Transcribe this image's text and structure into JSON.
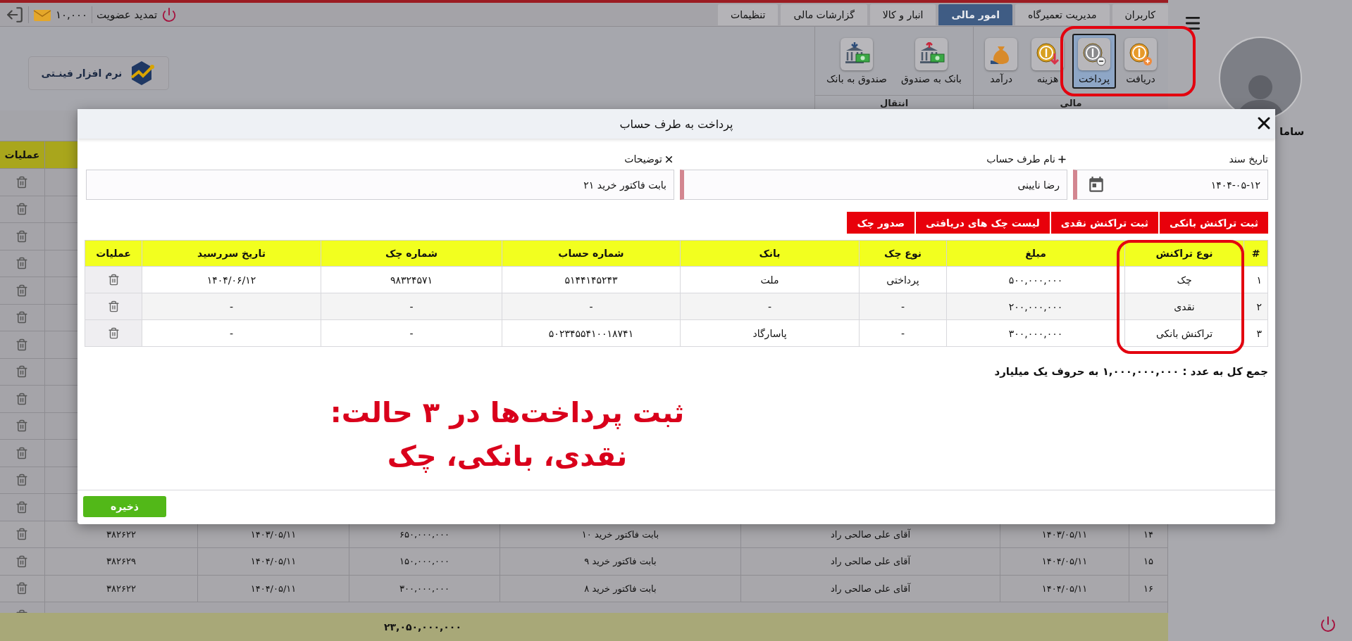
{
  "top_bar": {
    "sms_balance": "۱۰,۰۰۰",
    "renew_label": "تمدید عضویت"
  },
  "menu_tabs": [
    {
      "label": "کاربران",
      "selected": false
    },
    {
      "label": "مدیریت تعمیرگاه",
      "selected": false
    },
    {
      "label": "امور مالی",
      "selected": true
    },
    {
      "label": "انبار و کالا",
      "selected": false
    },
    {
      "label": "گزارشات مالی",
      "selected": false
    },
    {
      "label": "تنظیمات",
      "selected": false
    }
  ],
  "ribbon": {
    "groups": [
      {
        "title": "مالی",
        "items": [
          {
            "label": "دریافت",
            "selected": false
          },
          {
            "label": "پرداخت",
            "selected": true
          },
          {
            "label": "هزینه",
            "selected": false
          },
          {
            "label": "درآمد",
            "selected": false
          }
        ]
      },
      {
        "title": "انتقال",
        "items": [
          {
            "label": "بانک به صندوق",
            "selected": false
          },
          {
            "label": "صندوق به بانک",
            "selected": false
          }
        ]
      }
    ]
  },
  "logo": {
    "text": "نرم افزار فینـتی"
  },
  "sidebar": {
    "user_name": "ساما"
  },
  "background_table": {
    "operations_header": "عملیات",
    "total": "۲۳,۰۵۰,۰۰۰,۰۰۰",
    "rows": [
      {
        "covered": true
      },
      {
        "covered": true
      },
      {
        "covered": true
      },
      {
        "covered": true
      },
      {
        "covered": true
      },
      {
        "covered": true
      },
      {
        "covered": true
      },
      {
        "covered": true
      },
      {
        "covered": true
      },
      {
        "covered": true
      },
      {
        "covered": true
      },
      {
        "covered": true
      },
      {
        "covered": true
      },
      {
        "covered": false,
        "cells": [
          "۱۴",
          "۱۴۰۳/۰۵/۱۱",
          "آقای علی صالحی راد",
          "بابت فاکتور خرید ۱۰",
          "۶۵۰,۰۰۰,۰۰۰",
          "۱۴۰۳/۰۵/۱۱",
          "۳۸۲۶۲۲"
        ]
      },
      {
        "covered": false,
        "cells": [
          "۱۵",
          "۱۴۰۴/۰۵/۱۱",
          "آقای علی صالحی راد",
          "بابت فاکتور خرید ۹",
          "۱۵۰,۰۰۰,۰۰۰",
          "۱۴۰۴/۰۵/۱۱",
          "۳۸۲۶۲۹"
        ]
      },
      {
        "covered": false,
        "cells": [
          "۱۶",
          "۱۴۰۴/۰۵/۱۱",
          "آقای علی صالحی راد",
          "بابت فاکتور خرید ۸",
          "۳۰۰,۰۰۰,۰۰۰",
          "۱۴۰۴/۰۵/۱۱",
          "۳۸۲۶۲۲"
        ]
      },
      {
        "covered": true
      }
    ]
  },
  "dialog": {
    "title": "پرداخت به طرف حساب",
    "fields": [
      {
        "label": "تاریخ سند",
        "value": "۱۴۰۴-۰۵-۱۲",
        "kind": "date",
        "required": true
      },
      {
        "label": "نام طرف حساب",
        "value": "رضا نایینی",
        "kind": "add",
        "required": true
      },
      {
        "label": "توضیحات",
        "value": "بابت فاکتور خرید ۲۱",
        "kind": "clear",
        "required": false
      }
    ],
    "actions": [
      "ثبت تراکنش بانکی",
      "ثبت تراکنش نقدی",
      "لیست چک های دریافتی",
      "صدور چک"
    ],
    "table": {
      "columns": [
        "#",
        "نوع تراکنش",
        "مبلغ",
        "نوع چک",
        "بانک",
        "شماره حساب",
        "شماره چک",
        "تاریخ سررسید",
        "عملیات"
      ],
      "rows": [
        {
          "cells": [
            "۱",
            "چک",
            "۵۰۰,۰۰۰,۰۰۰",
            "پرداختی",
            "ملت",
            "۵۱۴۴۱۴۵۲۴۳",
            "۹۸۳۲۴۵۷۱",
            "۱۴۰۴/۰۶/۱۲"
          ]
        },
        {
          "cells": [
            "۲",
            "نقدی",
            "۲۰۰,۰۰۰,۰۰۰",
            "-",
            "-",
            "-",
            "-",
            "-"
          ]
        },
        {
          "cells": [
            "۳",
            "تراکنش بانکی",
            "۳۰۰,۰۰۰,۰۰۰",
            "-",
            "پاسارگاد",
            "۵۰۲۳۴۵۵۴۱۰۰۱۸۷۴۱",
            "-",
            "-"
          ]
        }
      ]
    },
    "total": "جمع کل به عدد : ۱,۰۰۰,۰۰۰,۰۰۰ به حروف یک میلیارد",
    "save_label": "ذخیره"
  },
  "annotation": {
    "lines": [
      "ثبت پرداخت‌ها در ۳ حالت:",
      "نقدی، بانکی، چک"
    ]
  }
}
